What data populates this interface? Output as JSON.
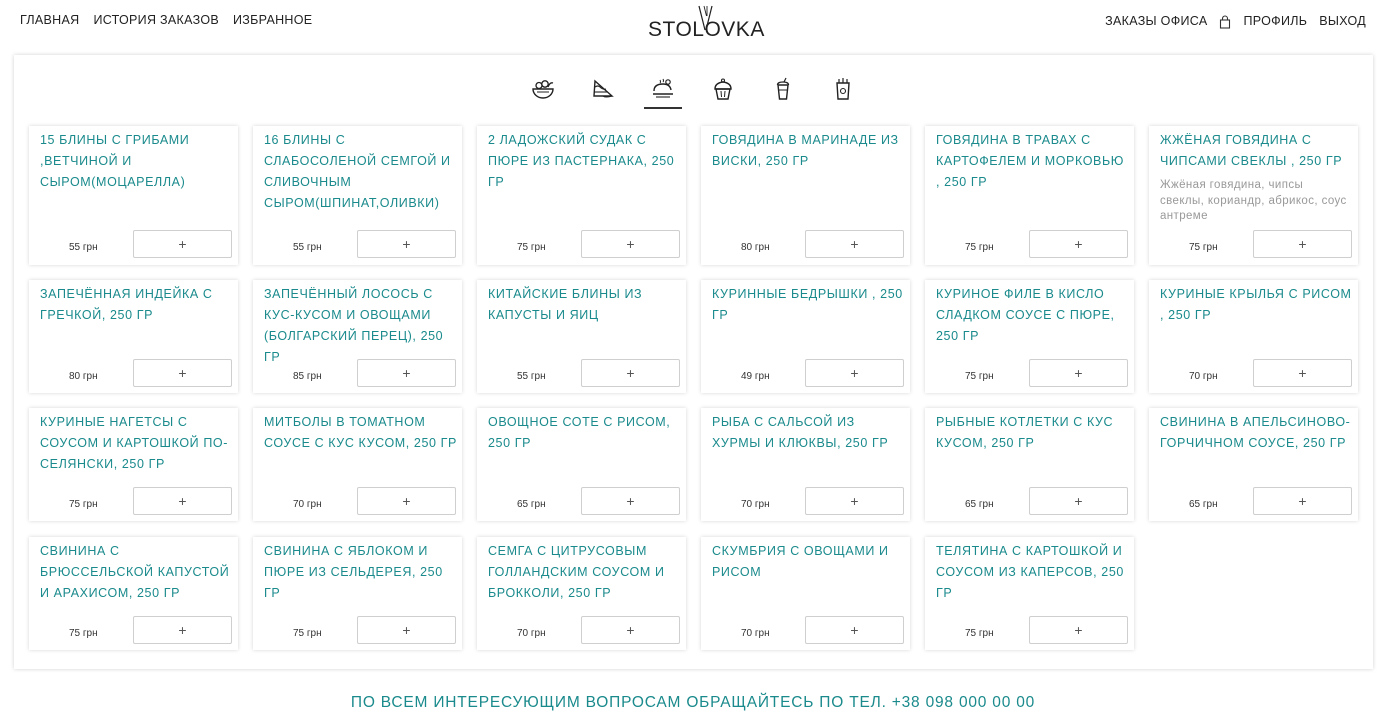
{
  "nav": {
    "left": [
      "ГЛАВНАЯ",
      "ИСТОРИЯ ЗАКАЗОВ",
      "ИЗБРАННОЕ"
    ],
    "right": [
      "ЗАКАЗЫ ОФИСА",
      "ПРОФИЛЬ",
      "ВЫХОД"
    ]
  },
  "logo": "STOLOVKA",
  "categories": [
    "salad-bowl-icon",
    "sandwich-icon",
    "hot-dish-icon",
    "cupcake-icon",
    "drink-cup-icon",
    "snack-bag-icon"
  ],
  "active_category": 2,
  "colors": {
    "accent": "#1a8a8c",
    "text": "#222222"
  },
  "add_label": "+",
  "items": [
    {
      "title": "15 БЛИНЫ С ГРИБАМИ ,ВЕТЧИНОЙ И СЫРОМ(МОЦАРЕЛЛА)",
      "desc": "",
      "price": "55 грн"
    },
    {
      "title": "16 БЛИНЫ С СЛАБОСОЛЕНОЙ СЕМГОЙ И СЛИВОЧНЫМ СЫРОМ(ШПИНАТ,ОЛИВКИ)",
      "desc": "",
      "price": "55 грн"
    },
    {
      "title": "2 ЛАДОЖСКИЙ СУДАК С ПЮРЕ ИЗ ПАСТЕРНАКА, 250 ГР",
      "desc": "",
      "price": "75 грн"
    },
    {
      "title": "ГОВЯДИНА В МАРИНАДЕ ИЗ ВИСКИ, 250 ГР",
      "desc": "",
      "price": "80 грн"
    },
    {
      "title": "ГОВЯДИНА В ТРАВАХ С КАРТОФЕЛЕМ И МОРКОВЬЮ , 250 ГР",
      "desc": "",
      "price": "75 грн"
    },
    {
      "title": "ЖЖЁНАЯ ГОВЯДИНА С ЧИПСАМИ СВЕКЛЫ , 250 ГР",
      "desc": "Жжёная говядина, чипсы свеклы, кориандр, абрикос, соус антреме",
      "price": "75 грн"
    },
    {
      "title": "ЗАПЕЧЁННАЯ ИНДЕЙКА С ГРЕЧКОЙ, 250 ГР",
      "desc": "",
      "price": "80 грн"
    },
    {
      "title": "ЗАПЕЧЁННЫЙ ЛОСОСЬ С КУС-КУСОМ И ОВОЩАМИ (БОЛГАРСКИЙ ПЕРЕЦ), 250 ГР",
      "desc": "",
      "price": "85 грн"
    },
    {
      "title": "КИТАЙСКИЕ БЛИНЫ ИЗ КАПУСТЫ И ЯИЦ",
      "desc": "",
      "price": "55 грн"
    },
    {
      "title": "КУРИННЫЕ БЕДРЫШКИ , 250 ГР",
      "desc": "",
      "price": "49 грн"
    },
    {
      "title": "КУРИНОЕ ФИЛЕ В КИСЛО СЛАДКОМ СОУСЕ С ПЮРЕ, 250 ГР",
      "desc": "",
      "price": "75 грн"
    },
    {
      "title": "КУРИНЫЕ КРЫЛЬЯ С РИСОМ , 250 ГР",
      "desc": "",
      "price": "70 грн"
    },
    {
      "title": "КУРИНЫЕ НАГЕТСЫ С СОУСОМ И КАРТОШКОЙ ПО-СЕЛЯНСКИ, 250 ГР",
      "desc": "",
      "price": "75 грн"
    },
    {
      "title": "МИТБОЛЫ В ТОМАТНОМ СОУСЕ С КУС КУСОМ, 250 ГР",
      "desc": "",
      "price": "70 грн"
    },
    {
      "title": "ОВОЩНОЕ СОТЕ С РИСОМ, 250 ГР",
      "desc": "",
      "price": "65 грн"
    },
    {
      "title": "РЫБА С САЛЬСОЙ ИЗ ХУРМЫ И КЛЮКВЫ, 250 ГР",
      "desc": "",
      "price": "70 грн"
    },
    {
      "title": "РЫБНЫЕ КОТЛЕТКИ С КУС КУСОМ, 250 ГР",
      "desc": "",
      "price": "65 грн"
    },
    {
      "title": "СВИНИНА В АПЕЛЬСИНОВО-ГОРЧИЧНОМ СОУСЕ, 250 ГР",
      "desc": "",
      "price": "65 грн"
    },
    {
      "title": "СВИНИНА С БРЮССЕЛЬСКОЙ КАПУСТОЙ И АРАХИСОМ, 250 ГР",
      "desc": "",
      "price": "75 грн"
    },
    {
      "title": "СВИНИНА С ЯБЛОКОМ И ПЮРЕ ИЗ СЕЛЬДЕРЕЯ, 250 ГР",
      "desc": "",
      "price": "75 грн"
    },
    {
      "title": "СЕМГА С ЦИТРУСОВЫМ ГОЛЛАНДСКИМ СОУСОМ И БРОККОЛИ, 250 ГР",
      "desc": "",
      "price": "70 грн"
    },
    {
      "title": "СКУМБРИЯ С ОВОЩАМИ И РИСОМ",
      "desc": "",
      "price": "70 грн"
    },
    {
      "title": "ТЕЛЯТИНА С КАРТОШКОЙ И СОУСОМ ИЗ КАПЕРСОВ, 250 ГР",
      "desc": "",
      "price": "75 грн"
    }
  ],
  "footer": "ПО ВСЕМ ИНТЕРЕСУЮЩИМ ВОПРОСАМ ОБРАЩАЙТЕСЬ ПО ТЕЛ. +38 098 000 00 00"
}
